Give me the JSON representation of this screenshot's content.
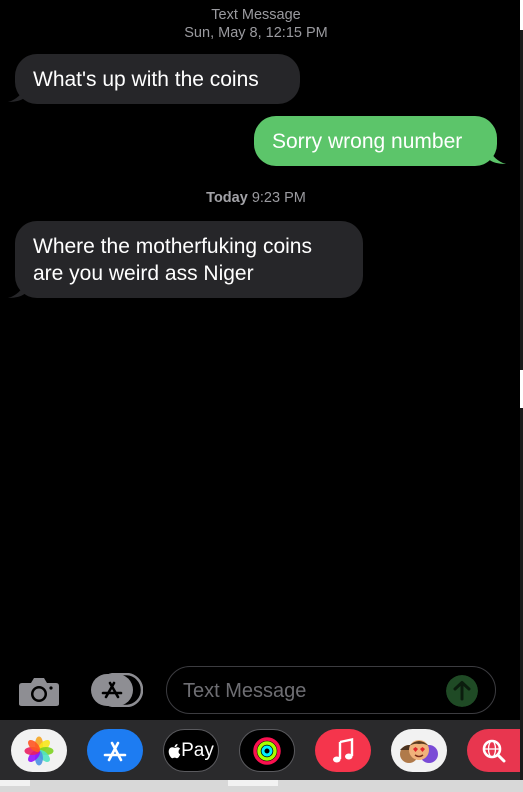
{
  "header": {
    "line1": "Text Message",
    "line2": "Sun, May 8, 12:15 PM"
  },
  "messages": [
    {
      "direction": "incoming",
      "text": "What's up with the coins"
    },
    {
      "direction": "outgoing",
      "text": "Sorry wrong number"
    },
    {
      "direction": "incoming",
      "lines": [
        "Where the motherfuking coins",
        "are you weird ass Niger"
      ]
    }
  ],
  "divider": {
    "day": "Today",
    "time": "9:23 PM"
  },
  "composer": {
    "placeholder": "Text Message"
  },
  "dock": {
    "apple_pay_label": "Pay",
    "apps": [
      "photos-icon",
      "app-store-icon",
      "apple-pay-icon",
      "activity-icon",
      "music-icon",
      "memoji-icon",
      "web-search-icon"
    ]
  },
  "colors": {
    "incoming_bubble": "#262629",
    "outgoing_bubble": "#5cc56a",
    "background": "#000000",
    "dock": "#2a2a2c"
  }
}
